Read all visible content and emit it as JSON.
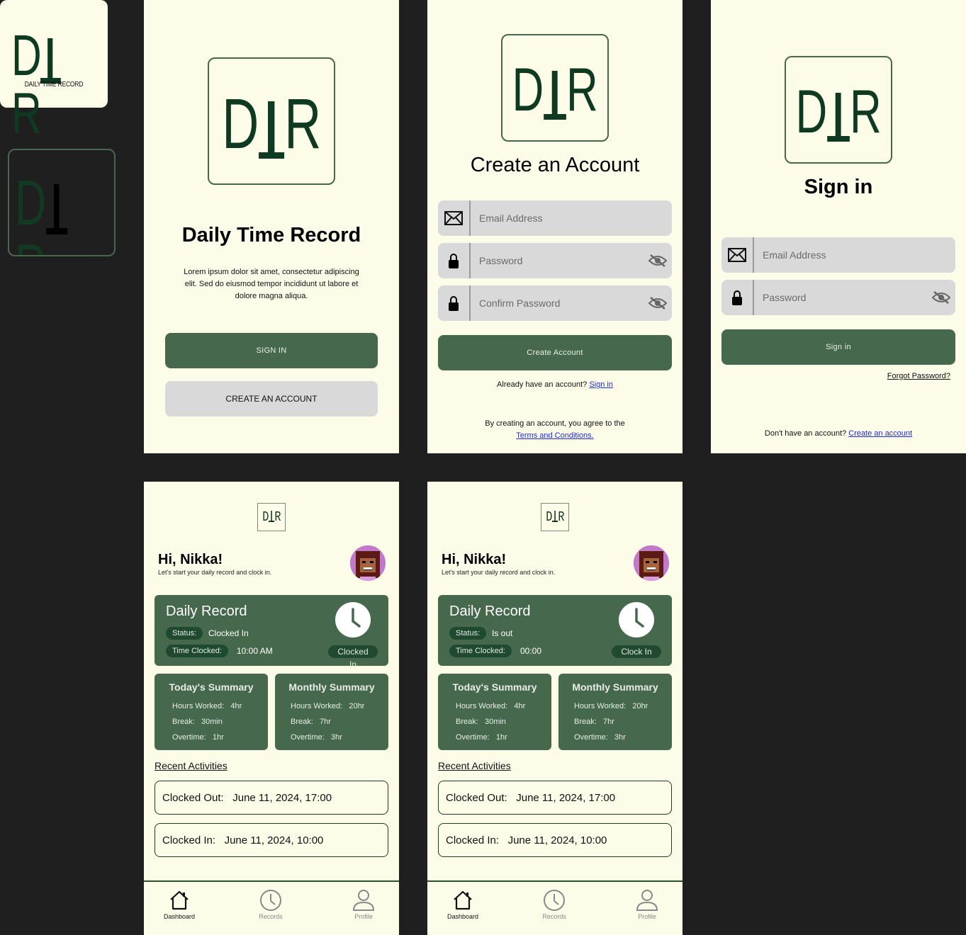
{
  "colors": {
    "background": "#1f1f1f",
    "screen": "#fdfce9",
    "primary": "#46694d",
    "dark": "#1f4a30",
    "gray": "#d9d9d9",
    "link": "#1d2bd6"
  },
  "logo": {
    "letters_left": "D",
    "letters_right": "R",
    "subtitle": "DAILY TIME RECORD"
  },
  "welcome": {
    "title": "Daily Time Record",
    "description": "Lorem ipsum dolor sit amet, consectetur adipiscing elit. Sed do eiusmod tempor incididunt ut labore et dolore magna aliqua.",
    "signin_label": "SIGN IN",
    "create_label": "CREATE AN ACCOUNT"
  },
  "create_account": {
    "title": "Create an Account",
    "email_placeholder": "Email Address",
    "password_placeholder": "Password",
    "confirm_placeholder": "Confirm Password",
    "button_label": "Create Account",
    "already_text": "Already have an account?",
    "signin_link": "Sign in",
    "agree_text": "By creating an account, you agree to the",
    "terms_link": "Terms and Conditions."
  },
  "signin": {
    "title": "Sign in",
    "email_placeholder": "Email Address",
    "password_placeholder": "Password",
    "button_label": "Sign in",
    "forgot_link": "Forgot Password?",
    "no_account_text": "Don't have an account?",
    "create_link": "Create an account"
  },
  "dashboards": [
    {
      "greeting": "Hi, Nikka!",
      "subtext": "Let's start your daily record and clock in.",
      "daily_title": "Daily Record",
      "status_label": "Status:",
      "status_value": "Clocked In",
      "time_label": "Time Clocked:",
      "time_value": "10:00 AM",
      "action_label": "Clocked In",
      "today_title": "Today's Summary",
      "today": {
        "hours_label": "Hours Worked:",
        "hours": "4hr",
        "break_label": "Break:",
        "break": "30min",
        "overtime_label": "Overtime:",
        "overtime": "1hr"
      },
      "monthly_title": "Monthly Summary",
      "monthly": {
        "hours_label": "Hours Worked:",
        "hours": "20hr",
        "break_label": "Break:",
        "break": "7hr",
        "overtime_label": "Overtime:",
        "overtime": "3hr"
      },
      "recent_title": "Recent Activities",
      "activities": [
        {
          "label": "Clocked Out:",
          "value": "June 11, 2024, 17:00"
        },
        {
          "label": "Clocked In:",
          "value": "June 11, 2024, 10:00"
        }
      ],
      "nav": {
        "dashboard": "Dashboard",
        "records": "Records",
        "profile": "Profile"
      }
    },
    {
      "greeting": "Hi, Nikka!",
      "subtext": "Let's start your daily record and clock in.",
      "daily_title": "Daily Record",
      "status_label": "Status:",
      "status_value": "Is out",
      "time_label": "Time Clocked:",
      "time_value": "00:00",
      "action_label": "Clock In",
      "today_title": "Today's Summary",
      "today": {
        "hours_label": "Hours Worked:",
        "hours": "4hr",
        "break_label": "Break:",
        "break": "30min",
        "overtime_label": "Overtime:",
        "overtime": "1hr"
      },
      "monthly_title": "Monthly Summary",
      "monthly": {
        "hours_label": "Hours Worked:",
        "hours": "20hr",
        "break_label": "Break:",
        "break": "7hr",
        "overtime_label": "Overtime:",
        "overtime": "3hr"
      },
      "recent_title": "Recent Activities",
      "activities": [
        {
          "label": "Clocked Out:",
          "value": "June 11, 2024, 17:00"
        },
        {
          "label": "Clocked In:",
          "value": "June 11, 2024, 10:00"
        }
      ],
      "nav": {
        "dashboard": "Dashboard",
        "records": "Records",
        "profile": "Profile"
      }
    }
  ]
}
